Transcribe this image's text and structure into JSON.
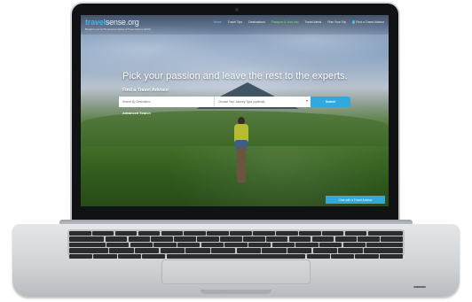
{
  "site": {
    "logo_main": "travel",
    "logo_tld": "sense.org",
    "tagline": "Brought to you by The American Society of Travel Advisors (ASTA)"
  },
  "nav": {
    "items": [
      {
        "label": "Home",
        "state": "active"
      },
      {
        "label": "Travel Tips",
        "state": "normal"
      },
      {
        "label": "Destinations",
        "state": "normal"
      },
      {
        "label": "Passport & Visa Info",
        "state": "highlight"
      },
      {
        "label": "Travel Alerts",
        "state": "normal"
      },
      {
        "label": "Plan Your Trip",
        "state": "normal"
      }
    ],
    "cta_label": "Find a Travel Advisor",
    "cta_icon": "map-pin-icon"
  },
  "hero": {
    "headline": "Pick your passion and leave the rest to the experts.",
    "find_label": "Find a Travel Advisor",
    "destination_placeholder": "Search By Destination",
    "journey_placeholder": "Choose Your Journey Type (optional)",
    "search_label": "Search",
    "advanced_label": "Advanced Search",
    "chat_label": "Chat with a Travel Advisor"
  },
  "colors": {
    "accent": "#2fa9df",
    "logo_blue": "#3ab8e6"
  }
}
